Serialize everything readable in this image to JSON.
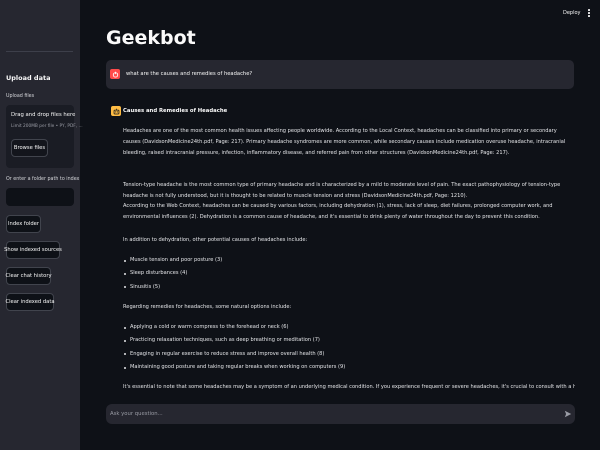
{
  "sidebar": {
    "upload_title": "Upload data",
    "upload_files_label": "Upload files",
    "drag_text": "Drag and drop files here",
    "limit_text": "Limit 200MB per file • PY, PDF, ...",
    "browse_label": "Browse files",
    "folder_label": "Or enter a folder path to index",
    "folder_value": "",
    "buttons": {
      "index_folder": "Index folder",
      "show_sources": "Show indexed sources",
      "clear_history": "Clear chat history",
      "clear_data": "Clear indexed data"
    }
  },
  "topbar": {
    "deploy_label": "Deploy",
    "menu_icon": "more-vertical-icon"
  },
  "app": {
    "title": "Geekbot"
  },
  "chat": {
    "user_message": "what are the causes and remedies of headache?",
    "bot_heading": "Causes and Remedies of Headache",
    "paragraphs": [
      "Headaches are one of the most common health issues affecting people worldwide. According to the Local Context, headaches can be classified into primary or secondary causes (DavidsonMedicine24th.pdf, Page: 217). Primary headache syndromes are more common, while secondary causes include medication overuse headache, intracranial bleeding, raised intracranial pressure, infection, inflammatory disease, and referred pain from other structures (DavidsonMedicine24th.pdf, Page: 217).",
      "Tension-type headache is the most common type of primary headache and is characterized by a mild to moderate level of pain. The exact pathophysiology of tension-type headache is not fully understood, but it is thought to be related to muscle tension and stress (DavidsonMedicine24th.pdf, Page: 1210).",
      "According to the Web Context, headaches can be caused by various factors, including dehydration (1), stress, lack of sleep, diet failures, prolonged computer work, and environmental influences (2). Dehydration is a common cause of headache, and it's essential to drink plenty of water throughout the day to prevent this condition.",
      "In addition to dehydration, other potential causes of headaches include:",
      "Regarding remedies for headaches, some natural options include:",
      "It's essential to note that some headaches may be a symptom of an underlying medical condition. If you experience frequent or severe headaches, it's crucial to consult with a healthcare professional for proper"
    ],
    "causes": [
      "Muscle tension and poor posture (3)",
      "Sleep disturbances (4)",
      "Sinusitis (5)"
    ],
    "remedies": [
      "Applying a cold or warm compress to the forehead or neck (6)",
      "Practicing relaxation techniques, such as deep breathing or meditation (7)",
      "Engaging in regular exercise to reduce stress and improve overall health (8)",
      "Maintaining good posture and taking regular breaks when working on computers (9)"
    ],
    "input_placeholder": "Ask your question...",
    "input_value": ""
  },
  "colors": {
    "background": "#0e1117",
    "sidebar": "#262730",
    "user_avatar": "#ff4b4b",
    "bot_avatar": "#ffbd45"
  }
}
